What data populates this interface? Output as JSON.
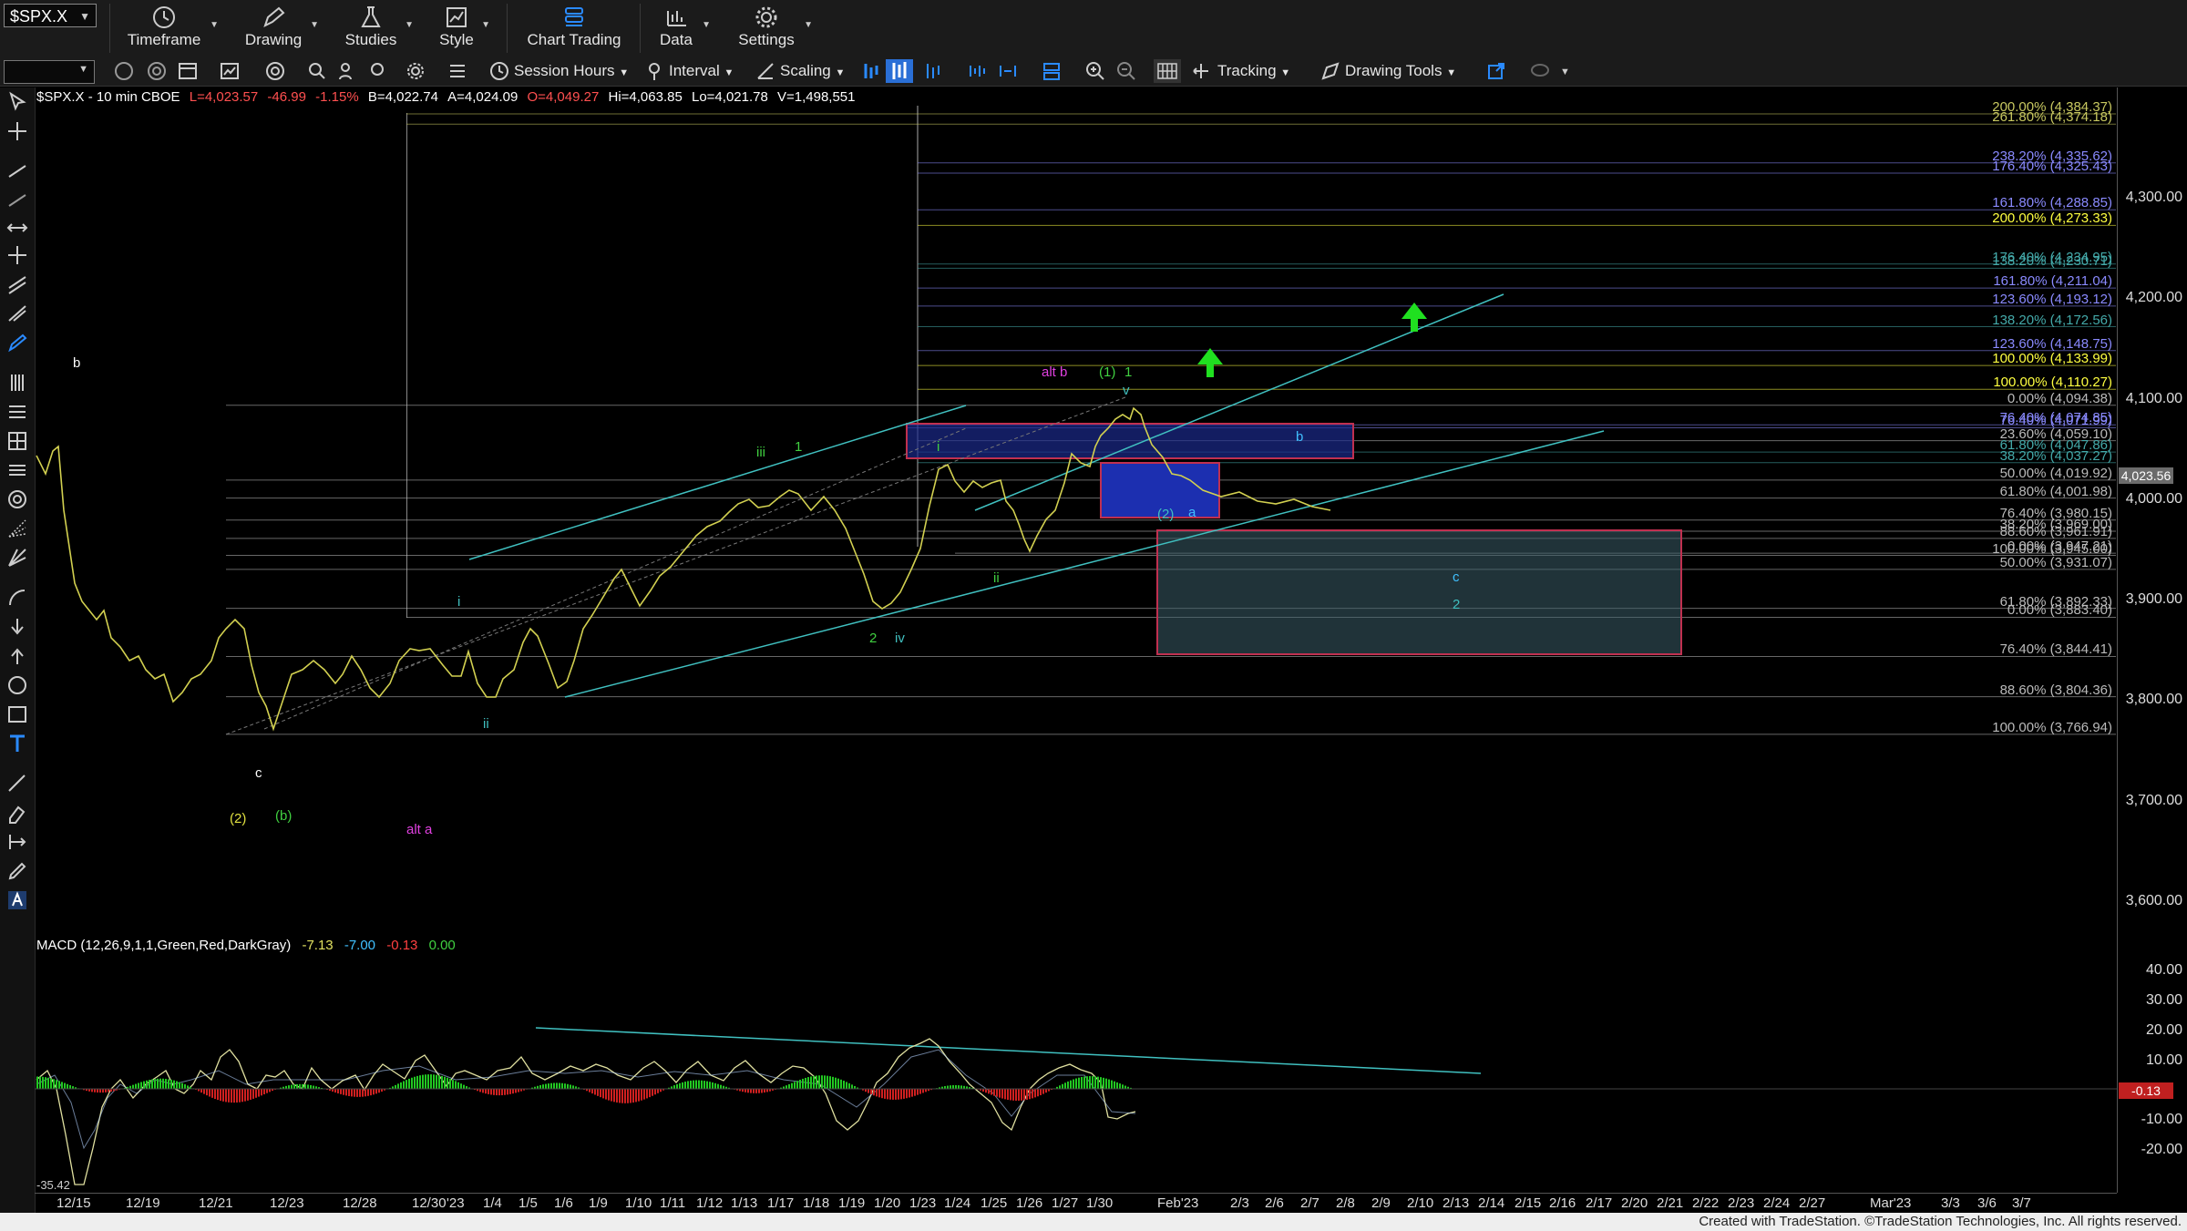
{
  "toolbar": {
    "symbol": "$SPX.X",
    "items": [
      {
        "label": "Timeframe",
        "icon": "clock-icon"
      },
      {
        "label": "Drawing",
        "icon": "pen-icon"
      },
      {
        "label": "Studies",
        "icon": "flask-icon"
      },
      {
        "label": "Style",
        "icon": "chart-style-icon"
      },
      {
        "label": "Chart Trading",
        "icon": "chart-trading-icon"
      },
      {
        "label": "Data",
        "icon": "bar-chart-icon"
      },
      {
        "label": "Settings",
        "icon": "gear-icon"
      }
    ]
  },
  "toolbar2": {
    "session_hours": "Session Hours",
    "interval": "Interval",
    "scaling": "Scaling",
    "tracking": "Tracking",
    "drawing_tools": "Drawing Tools"
  },
  "header": {
    "symbol_info": "$SPX.X - 10 min  CBOE",
    "last": "L=4,023.57",
    "change": "-46.99",
    "change_pct": "-1.15%",
    "bid": "B=4,022.74",
    "ask": "A=4,024.09",
    "open": "O=4,049.27",
    "high": "Hi=4,063.85",
    "low": "Lo=4,021.78",
    "volume": "V=1,498,551"
  },
  "macd": {
    "label": "MACD (12,26,9,1,1,Green,Red,DarkGray)",
    "v1": "-7.13",
    "v2": "-7.00",
    "v3": "-0.13",
    "v4": "0.00",
    "low_label": "-35.42"
  },
  "price_axis": [
    "4,300.00",
    "4,200.00",
    "4,100.00",
    "4,000.00",
    "3,900.00",
    "3,800.00",
    "3,700.00",
    "3,600.00"
  ],
  "macd_axis": [
    "40.00",
    "30.00",
    "20.00",
    "10.00",
    "-10.00",
    "-20.00"
  ],
  "macd_tag": "-0.13",
  "last_price_tag": "4,023.56",
  "x_axis": [
    "12/15",
    "12/19",
    "12/21",
    "12/23",
    "12/28",
    "12/30",
    "'23",
    "1/4",
    "1/5",
    "1/6",
    "1/9",
    "1/10",
    "1/11",
    "1/12",
    "1/13",
    "1/17",
    "1/18",
    "1/19",
    "1/20",
    "1/23",
    "1/24",
    "1/25",
    "1/26",
    "1/27",
    "1/30",
    "Feb'23",
    "2/3",
    "2/6",
    "2/7",
    "2/8",
    "2/9",
    "2/10",
    "2/13",
    "2/14",
    "2/15",
    "2/16",
    "2/17",
    "2/20",
    "2/21",
    "2/22",
    "2/23",
    "2/24",
    "2/27",
    "Mar'23",
    "3/3",
    "3/6",
    "3/7"
  ],
  "fib_labels": [
    {
      "text": "200.00% (4,384.37)",
      "color": "#c8c860"
    },
    {
      "text": "261.80% (4,374.18)",
      "color": "#c8c860"
    },
    {
      "text": "238.20% (4,335.62)",
      "color": "#8a8aff"
    },
    {
      "text": "176.40% (4,325.43)",
      "color": "#8a8aff"
    },
    {
      "text": "161.80% (4,288.85)",
      "color": "#8a8aff"
    },
    {
      "text": "200.00% (4,273.33)",
      "color": "#ffff40"
    },
    {
      "text": "176.40% (4,234.95)",
      "color": "#4aa"
    },
    {
      "text": "138.20% (4,230.71)",
      "color": "#4aa"
    },
    {
      "text": "161.80% (4,211.04)",
      "color": "#8a8aff"
    },
    {
      "text": "123.60% (4,193.12)",
      "color": "#8a8aff"
    },
    {
      "text": "138.20% (4,172.56)",
      "color": "#4aa"
    },
    {
      "text": "123.60% (4,148.75)",
      "color": "#8a8aff"
    },
    {
      "text": "100.00% (4,133.99)",
      "color": "#ffff40"
    },
    {
      "text": "100.00% (4,110.27)",
      "color": "#ffff40"
    },
    {
      "text": "0.00% (4,094.38)",
      "color": "#bbb"
    },
    {
      "text": "76.40% (4,074.85)",
      "color": "#8a8aff"
    },
    {
      "text": "76.40% (4,071.99)",
      "color": "#8a8aff"
    },
    {
      "text": "23.60% (4,059.10)",
      "color": "#bbb"
    },
    {
      "text": "61.80% (4,047.86)",
      "color": "#4aa"
    },
    {
      "text": "38.20% (4,037.27)",
      "color": "#4aa"
    },
    {
      "text": "50.00% (4,019.92)",
      "color": "#bbb"
    },
    {
      "text": "61.80% (4,001.98)",
      "color": "#bbb"
    },
    {
      "text": "76.40% (3,980.15)",
      "color": "#bbb"
    },
    {
      "text": "38.20% (3,969.00)",
      "color": "#bbb"
    },
    {
      "text": "88.60% (3,961.91)",
      "color": "#bbb"
    },
    {
      "text": "0.00% (3,947.21)",
      "color": "#bbb"
    },
    {
      "text": "100.00% (3,945.00)",
      "color": "#bbb"
    },
    {
      "text": "50.00% (3,931.07)",
      "color": "#bbb"
    },
    {
      "text": "61.80% (3,892.33)",
      "color": "#bbb"
    },
    {
      "text": "0.00% (3,883.40)",
      "color": "#bbb"
    },
    {
      "text": "76.40% (3,844.41)",
      "color": "#bbb"
    },
    {
      "text": "88.60% (3,804.36)",
      "color": "#bbb"
    },
    {
      "text": "100.00% (3,766.94)",
      "color": "#bbb"
    }
  ],
  "wave_labels": [
    {
      "text": "b",
      "color": "#ffffff"
    },
    {
      "text": "c",
      "color": "#ffffff"
    },
    {
      "text": "(2)",
      "color": "#e0e040"
    },
    {
      "text": "(b)",
      "color": "#40d040"
    },
    {
      "text": "alt a",
      "color": "#e040e0"
    },
    {
      "text": "i",
      "color": "#40c0c0"
    },
    {
      "text": "ii",
      "color": "#40c0c0"
    },
    {
      "text": "iii",
      "color": "#40d040"
    },
    {
      "text": "1",
      "color": "#40d040"
    },
    {
      "text": "2",
      "color": "#40d040"
    },
    {
      "text": "iv",
      "color": "#40c0c0"
    },
    {
      "text": "i",
      "color": "#40d040"
    },
    {
      "text": "ii",
      "color": "#40d040"
    },
    {
      "text": "alt b",
      "color": "#e040e0"
    },
    {
      "text": "(1)",
      "color": "#40d040"
    },
    {
      "text": "1",
      "color": "#40d040"
    },
    {
      "text": "v",
      "color": "#40c0c0"
    },
    {
      "text": "b",
      "color": "#40c0ff"
    },
    {
      "text": "(2)",
      "color": "#40c0c0"
    },
    {
      "text": "a",
      "color": "#40c0ff"
    },
    {
      "text": "c",
      "color": "#40c0ff"
    },
    {
      "text": "2",
      "color": "#40c0c0"
    }
  ],
  "footer": "Created with TradeStation. ©TradeStation Technologies, Inc. All rights reserved."
}
